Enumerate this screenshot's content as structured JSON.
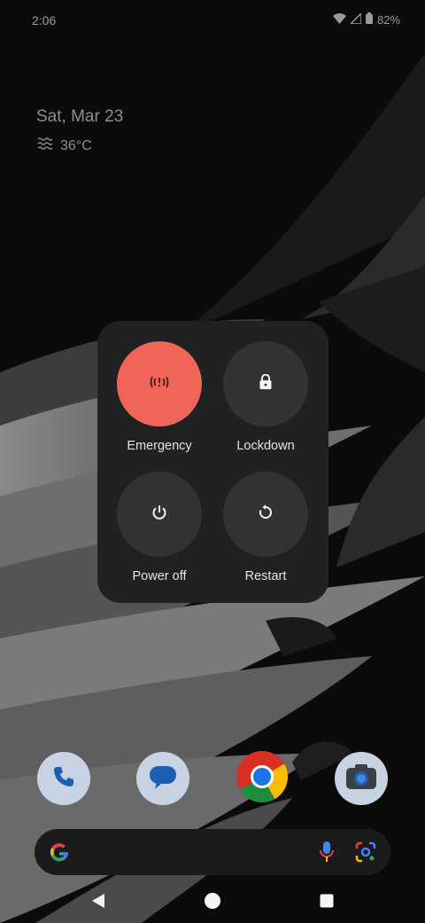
{
  "status_bar": {
    "time": "2:06",
    "battery": "82%"
  },
  "widget": {
    "date": "Sat, Mar 23",
    "temperature": "36°C"
  },
  "power_menu": {
    "items": [
      {
        "label": "Emergency",
        "icon": "emergency-icon"
      },
      {
        "label": "Lockdown",
        "icon": "lock-icon"
      },
      {
        "label": "Power off",
        "icon": "power-icon"
      },
      {
        "label": "Restart",
        "icon": "restart-icon"
      }
    ]
  },
  "dock": {
    "apps": [
      {
        "name": "Phone",
        "icon": "phone-icon"
      },
      {
        "name": "Messages",
        "icon": "messages-icon"
      },
      {
        "name": "Chrome",
        "icon": "chrome-icon"
      },
      {
        "name": "Camera",
        "icon": "camera-icon"
      }
    ]
  },
  "search_bar": {
    "icons": [
      "google-g-icon",
      "microphone-icon",
      "lens-icon"
    ]
  },
  "nav_bar": {
    "buttons": [
      "back-icon",
      "home-icon",
      "recents-icon"
    ]
  },
  "colors": {
    "emergency": "#f0645a",
    "menu_bg": "#202222",
    "button_bg": "#323434",
    "dock_bg": "#3a3d3f"
  }
}
